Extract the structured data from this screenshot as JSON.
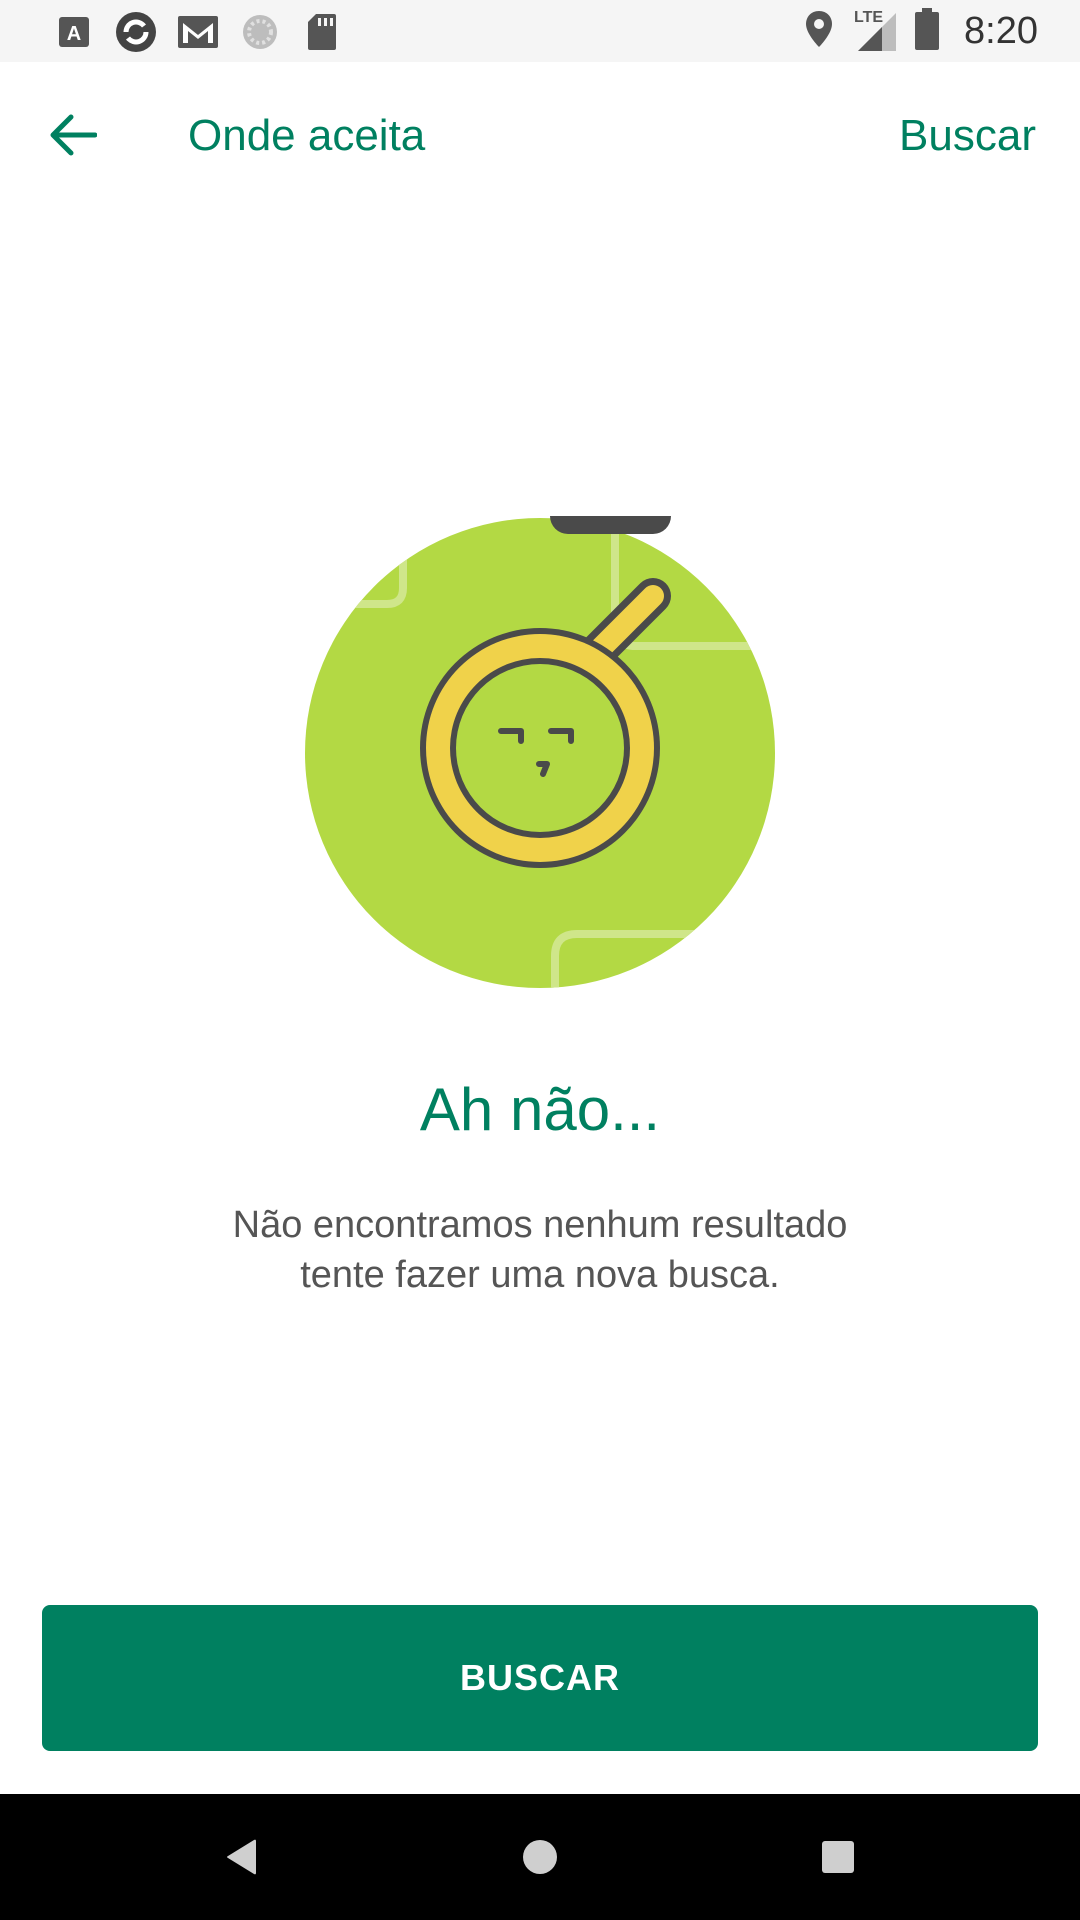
{
  "status_bar": {
    "time": "8:20",
    "network_label": "LTE",
    "left_icons": [
      "font-a-icon",
      "refresh-app-icon",
      "gmail-icon",
      "loading-circle-icon",
      "sd-card-icon"
    ],
    "right_icons": [
      "location-icon",
      "signal-icon",
      "battery-icon"
    ]
  },
  "app_bar": {
    "title": "Onde aceita",
    "action_label": "Buscar",
    "back_icon": "arrow-left-icon"
  },
  "empty_state": {
    "title": "Ah não...",
    "message_line1": "Não encontramos nenhum resultado",
    "message_line2": "tente fazer uma nova busca.",
    "illustration_icon": "magnifier-face-icon"
  },
  "primary_button": {
    "label": "BUSCAR"
  },
  "nav_bar": {
    "back_icon": "nav-back-icon",
    "home_icon": "nav-home-icon",
    "recents_icon": "nav-recents-icon"
  },
  "colors": {
    "accent": "#008060",
    "illustration_bg": "#B3D944",
    "magnifier": "#F0D24A",
    "outline": "#4A4A4A",
    "nav_bar": "#000000",
    "status_bar": "#F5F5F5"
  }
}
